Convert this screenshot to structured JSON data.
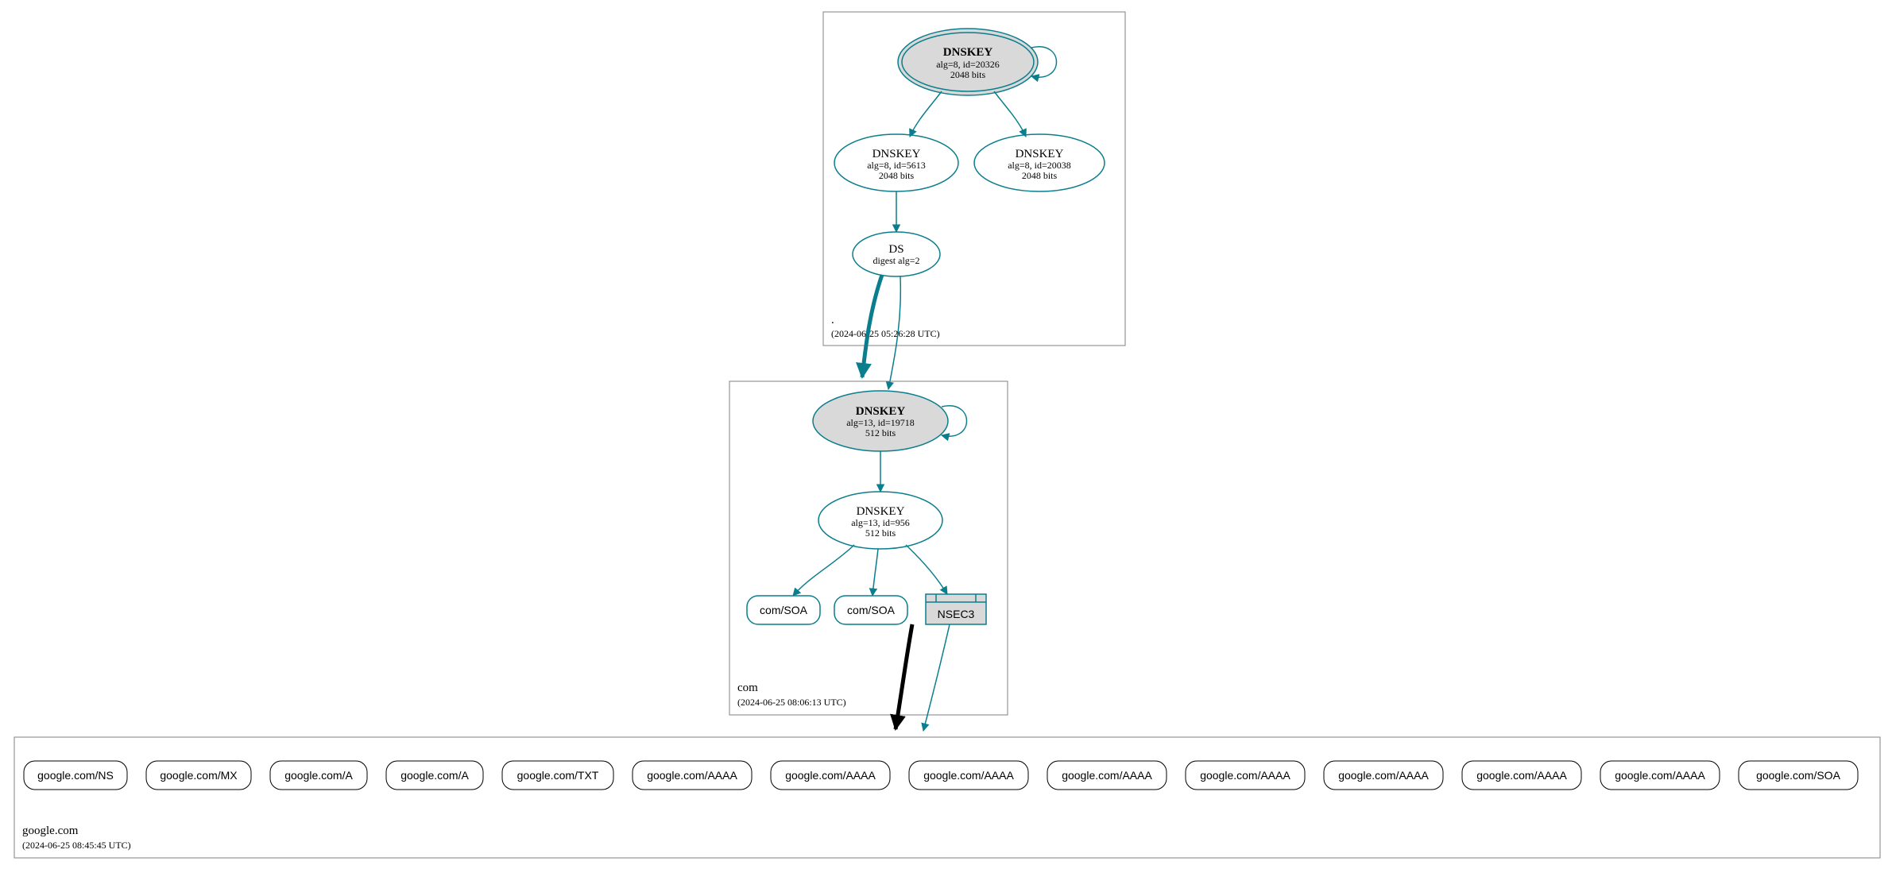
{
  "colors": {
    "teal": "#0a7e8c",
    "kskFill": "#d9d9d9"
  },
  "zones": {
    "root": {
      "name": ".",
      "timestamp": "(2024-06-25 05:26:28 UTC)",
      "nodes": {
        "ksk": {
          "title": "DNSKEY",
          "line2": "alg=8, id=20326",
          "line3": "2048 bits"
        },
        "zsk1": {
          "title": "DNSKEY",
          "line2": "alg=8, id=5613",
          "line3": "2048 bits"
        },
        "zsk2": {
          "title": "DNSKEY",
          "line2": "alg=8, id=20038",
          "line3": "2048 bits"
        },
        "ds": {
          "title": "DS",
          "line2": "digest alg=2"
        }
      }
    },
    "com": {
      "name": "com",
      "timestamp": "(2024-06-25 08:06:13 UTC)",
      "nodes": {
        "ksk": {
          "title": "DNSKEY",
          "line2": "alg=13, id=19718",
          "line3": "512 bits"
        },
        "zsk": {
          "title": "DNSKEY",
          "line2": "alg=13, id=956",
          "line3": "512 bits"
        },
        "soa1": {
          "title": "com/SOA"
        },
        "soa2": {
          "title": "com/SOA"
        },
        "nsec3": {
          "title": "NSEC3"
        }
      }
    },
    "google": {
      "name": "google.com",
      "timestamp": "(2024-06-25 08:45:45 UTC)",
      "records": [
        "google.com/NS",
        "google.com/MX",
        "google.com/A",
        "google.com/A",
        "google.com/TXT",
        "google.com/AAAA",
        "google.com/AAAA",
        "google.com/AAAA",
        "google.com/AAAA",
        "google.com/AAAA",
        "google.com/AAAA",
        "google.com/AAAA",
        "google.com/AAAA",
        "google.com/SOA"
      ]
    }
  }
}
